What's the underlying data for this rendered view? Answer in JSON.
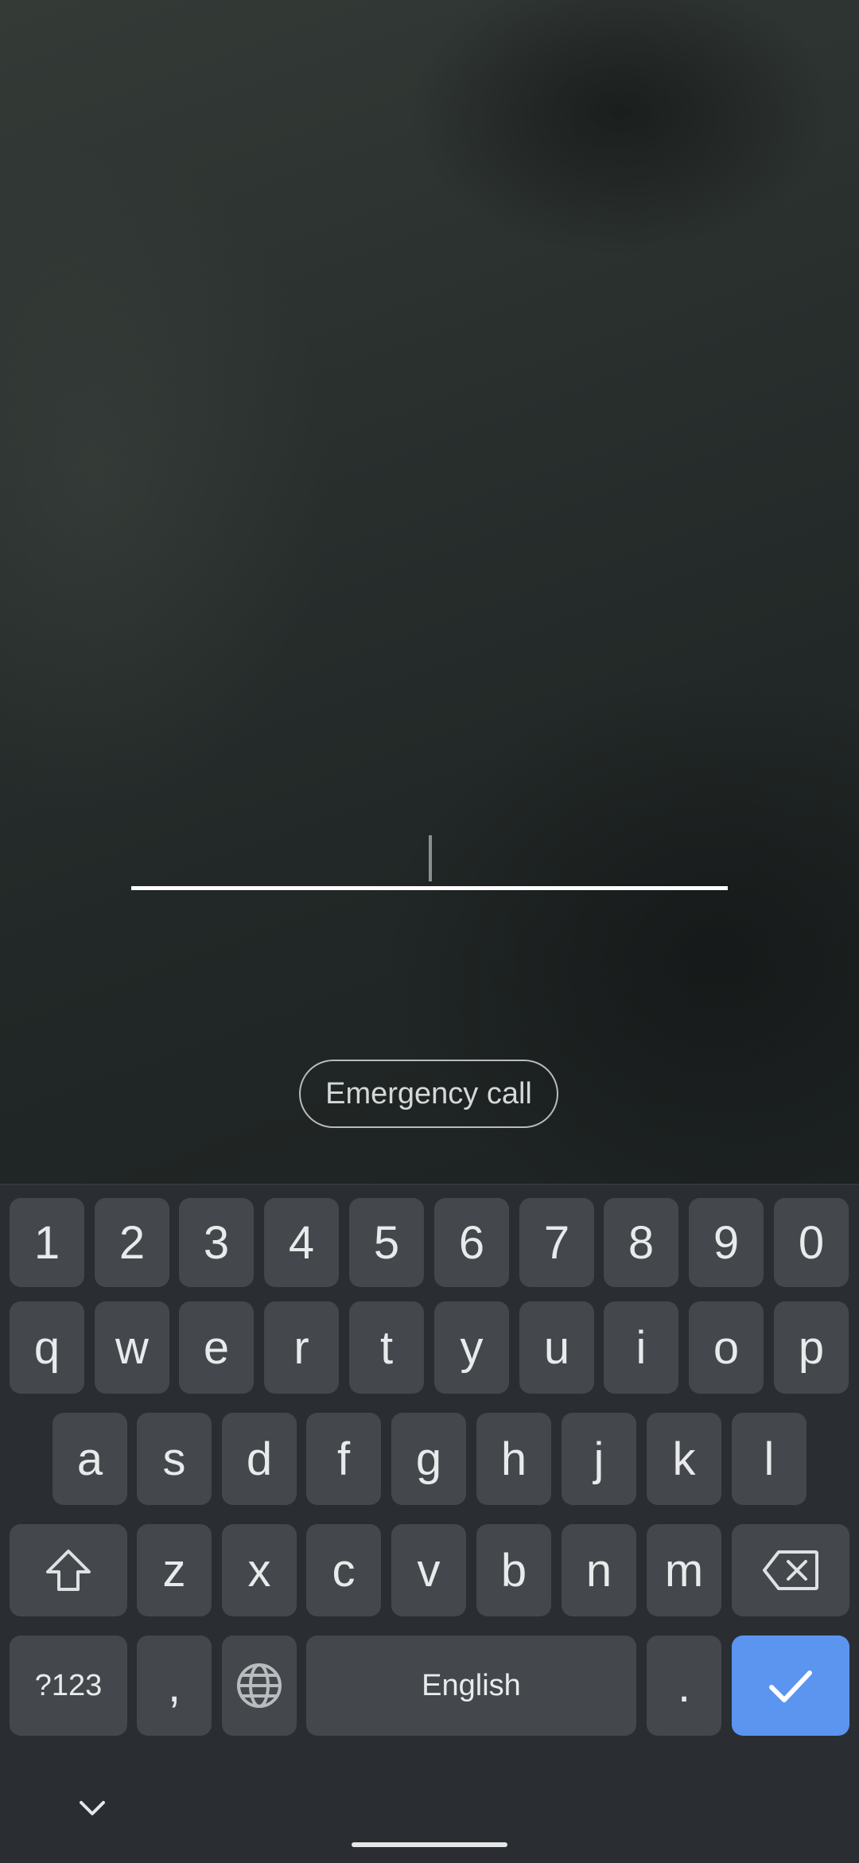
{
  "lockscreen": {
    "emergency_label": "Emergency call"
  },
  "keyboard": {
    "row_numbers": [
      "1",
      "2",
      "3",
      "4",
      "5",
      "6",
      "7",
      "8",
      "9",
      "0"
    ],
    "row_top": [
      "q",
      "w",
      "e",
      "r",
      "t",
      "y",
      "u",
      "i",
      "o",
      "p"
    ],
    "row_middle": [
      "a",
      "s",
      "d",
      "f",
      "g",
      "h",
      "j",
      "k",
      "l"
    ],
    "row_bottom": [
      "z",
      "x",
      "c",
      "v",
      "b",
      "n",
      "m"
    ],
    "symbols_label": "?123",
    "comma_label": ",",
    "space_label": "English",
    "period_label": ".",
    "icons": {
      "shift": "shift-icon",
      "backspace": "backspace-icon",
      "language": "globe-icon",
      "enter": "check-icon",
      "collapse": "chevron-down-icon"
    },
    "accent_color": "#5b95f0"
  }
}
